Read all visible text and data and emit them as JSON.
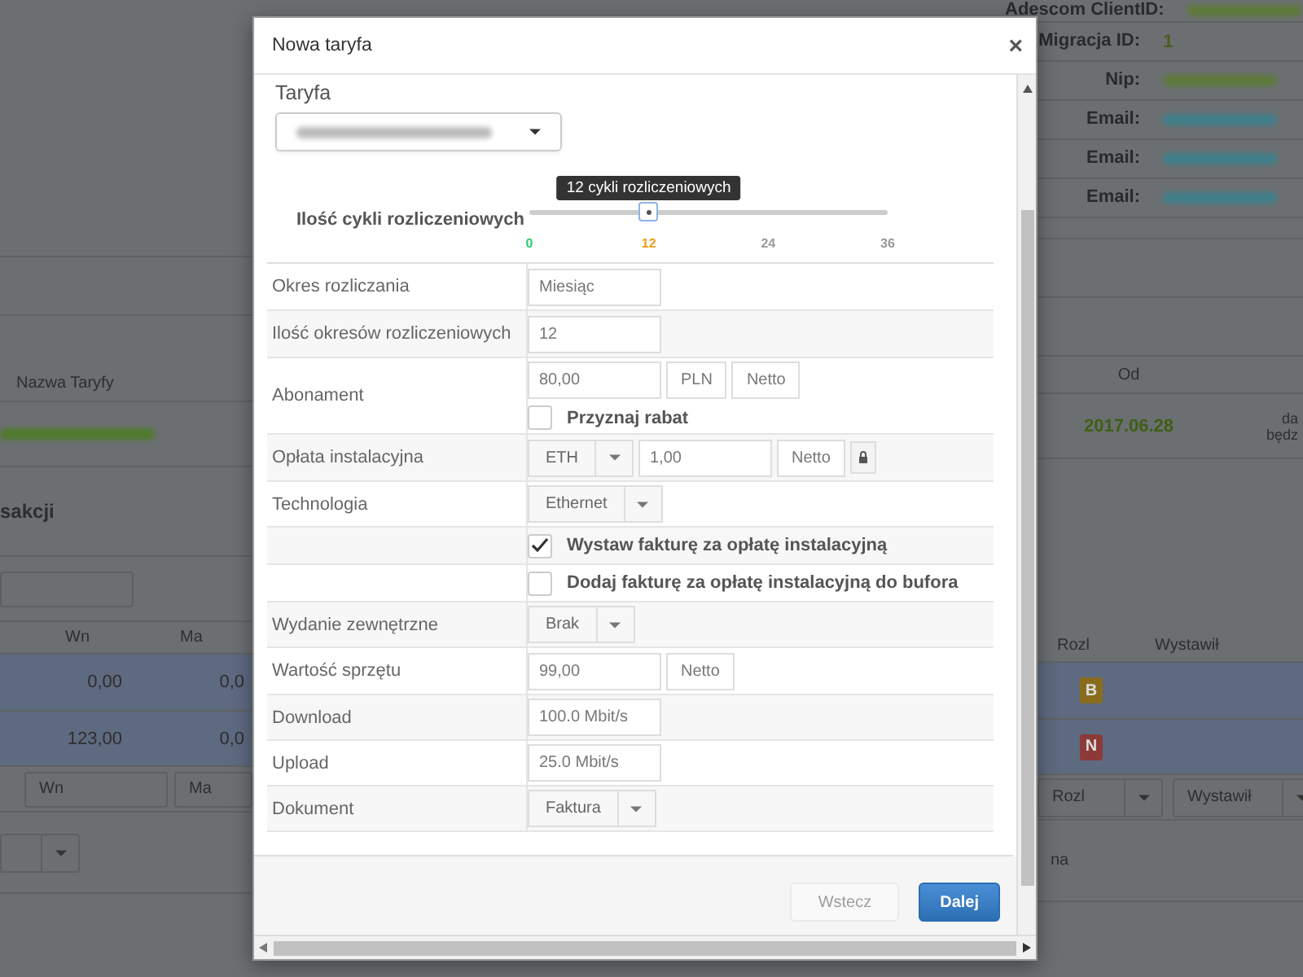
{
  "background": {
    "client_info": [
      {
        "label": "Adescom ClientID:",
        "color": "#5d7a3a"
      },
      {
        "label": "Migracja ID:",
        "value": "1"
      },
      {
        "label": "Nip:",
        "color": "#5d7a3a"
      },
      {
        "label": "Email:",
        "color": "#3f7f8a"
      },
      {
        "label": "Email:",
        "color": "#3f7f8a"
      },
      {
        "label": "Email:",
        "color": "#3f7f8a"
      }
    ],
    "tariffs": {
      "name_header": "Nazwa Taryfy",
      "from_header": "Od",
      "from_value": "2017.06.28",
      "cut_texts": [
        "da",
        "będz"
      ]
    },
    "section_title": "sakcji",
    "left_columns": [
      "Wn",
      "Ma"
    ],
    "left_rows": [
      {
        "wn": "0,00",
        "ma": "0,0"
      },
      {
        "wn": "123,00",
        "ma": "0,0"
      }
    ],
    "left_filters": [
      "Wn",
      "Ma"
    ],
    "right_columns": [
      "Rozl",
      "Wystawił"
    ],
    "right_badges": [
      {
        "text": "B",
        "color": "#8a6d1c"
      },
      {
        "text": "N",
        "color": "#8c3a38"
      }
    ],
    "right_filters": [
      "Rozl",
      "Wystawił"
    ],
    "cut_button": "na"
  },
  "dialog": {
    "title": "Nowa taryfa",
    "close": "×"
  },
  "tariff": {
    "label": "Taryfa"
  },
  "cycles": {
    "label": "Ilość cykli rozliczeniowych",
    "tooltip": "12 cykli rozliczeniowych",
    "level": 0.3333,
    "ticks": [
      {
        "label": "0",
        "color": "#2ecc71"
      },
      {
        "label": "12",
        "color": "#f39c12"
      },
      {
        "label": "24",
        "color": "#999999"
      },
      {
        "label": "36",
        "color": "#999999"
      }
    ]
  },
  "rows": [
    {
      "kind": "input",
      "label": "Okres rozliczania",
      "value": "Miesiąc"
    },
    {
      "kind": "input",
      "label": "Ilość okresów rozliczeniowych",
      "value": "12"
    },
    {
      "kind": "price",
      "label": "Abonament",
      "value": "80,00",
      "currency": "PLN",
      "tax": "Netto",
      "checkbox": {
        "label": "Przyznaj rabat",
        "checked": false
      }
    },
    {
      "kind": "install",
      "label": "Opłata instalacyjna",
      "select": "ETH",
      "value": "1,00",
      "tax": "Netto"
    },
    {
      "kind": "select",
      "label": "Technologia",
      "value": "Ethernet"
    },
    {
      "kind": "check",
      "label": "Wystaw fakturę za opłatę instalacyjną",
      "checked": true
    },
    {
      "kind": "check",
      "label": "Dodaj fakturę za opłatę instalacyjną do bufora",
      "checked": false
    },
    {
      "kind": "select",
      "label": "Wydanie zewnętrzne",
      "value": "Brak"
    },
    {
      "kind": "price",
      "label": "Wartość sprzętu",
      "value": "99,00",
      "tax": "Netto"
    },
    {
      "kind": "input",
      "label": "Download",
      "value": "100.0 Mbit/s"
    },
    {
      "kind": "input",
      "label": "Upload",
      "value": "25.0 Mbit/s"
    },
    {
      "kind": "select",
      "label": "Dokument",
      "value": "Faktura"
    }
  ],
  "buttons": [
    {
      "label": "Wstecz",
      "kind": "default",
      "disabled": true
    },
    {
      "label": "Dalej",
      "kind": "primary",
      "disabled": false
    }
  ]
}
